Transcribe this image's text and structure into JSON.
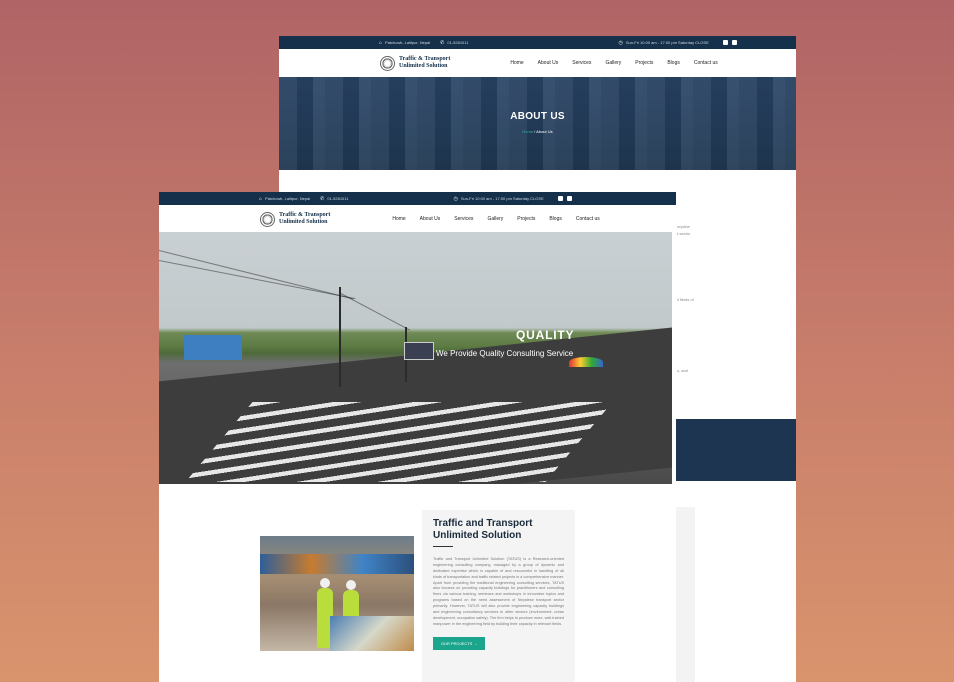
{
  "back_page": {
    "topbar": {
      "address": "Patchowk, Lalitpur, Nepal",
      "phone": "01-5261011",
      "hours": "Sun-Fri 10:00 am - 17:00 pm Saturday CLOSE"
    },
    "logo": {
      "line1": "Traffic & Transport",
      "line2": "Unlimited Solution"
    },
    "menu": [
      "Home",
      "About Us",
      "Services",
      "Gallery",
      "Projects",
      "Blogs",
      "Contact us"
    ],
    "hero": {
      "title": "ABOUT US",
      "crumb_home": "Home",
      "crumb_sep": " / ",
      "crumb_current": "About Us"
    },
    "fragments": [
      "onpline",
      "t-sector",
      "ll fields of",
      "s, and"
    ]
  },
  "front_page": {
    "topbar": {
      "address": "Patchowk, Lalitpur, Nepal",
      "phone": "01-5261011",
      "hours": "Sun-Fri 10:00 am - 17:00 pm Saturday CLOSE"
    },
    "logo": {
      "line1": "Traffic & Transport",
      "line2": "Unlimited Solution"
    },
    "menu": [
      "Home",
      "About Us",
      "Services",
      "Gallery",
      "Projects",
      "Blogs",
      "Contact us"
    ],
    "hero": {
      "heading": "QUALITY",
      "subheading": "We Provide Quality Consulting Service"
    },
    "story": {
      "title": "Traffic and Transport Unlimited Solution",
      "body": "Traffic and Transport Unlimited Solution (TATUS) is a Research-oriented engineering consulting company, managed by a group of dynamic and dedicated expertise which is capable of and resourceful in handling of all kinds of transportation and traffic related projects in a comprehensive manner. Apart from providing the traditional engineering consulting services, TATUS also focuses on providing capacity buildings for practitioners and consulting firms via various training, seminars and workshops in innovative topics and programs based on the need assessment of Nepalese transport sector primarily. However, TATUS will also provide engineering capacity buildings and engineering consultancy services in other sectors (environment, urban development, occupation safety). The firm helps to produce more, well-trained manpower in the engineering field by building their capacity in relevant fields.",
      "button": "OUR PROJECTS →"
    }
  },
  "colors": {
    "navy": "#14304a",
    "teal": "#1aa58c",
    "bg_top": "#b06466",
    "bg_bottom": "#d9946d"
  }
}
